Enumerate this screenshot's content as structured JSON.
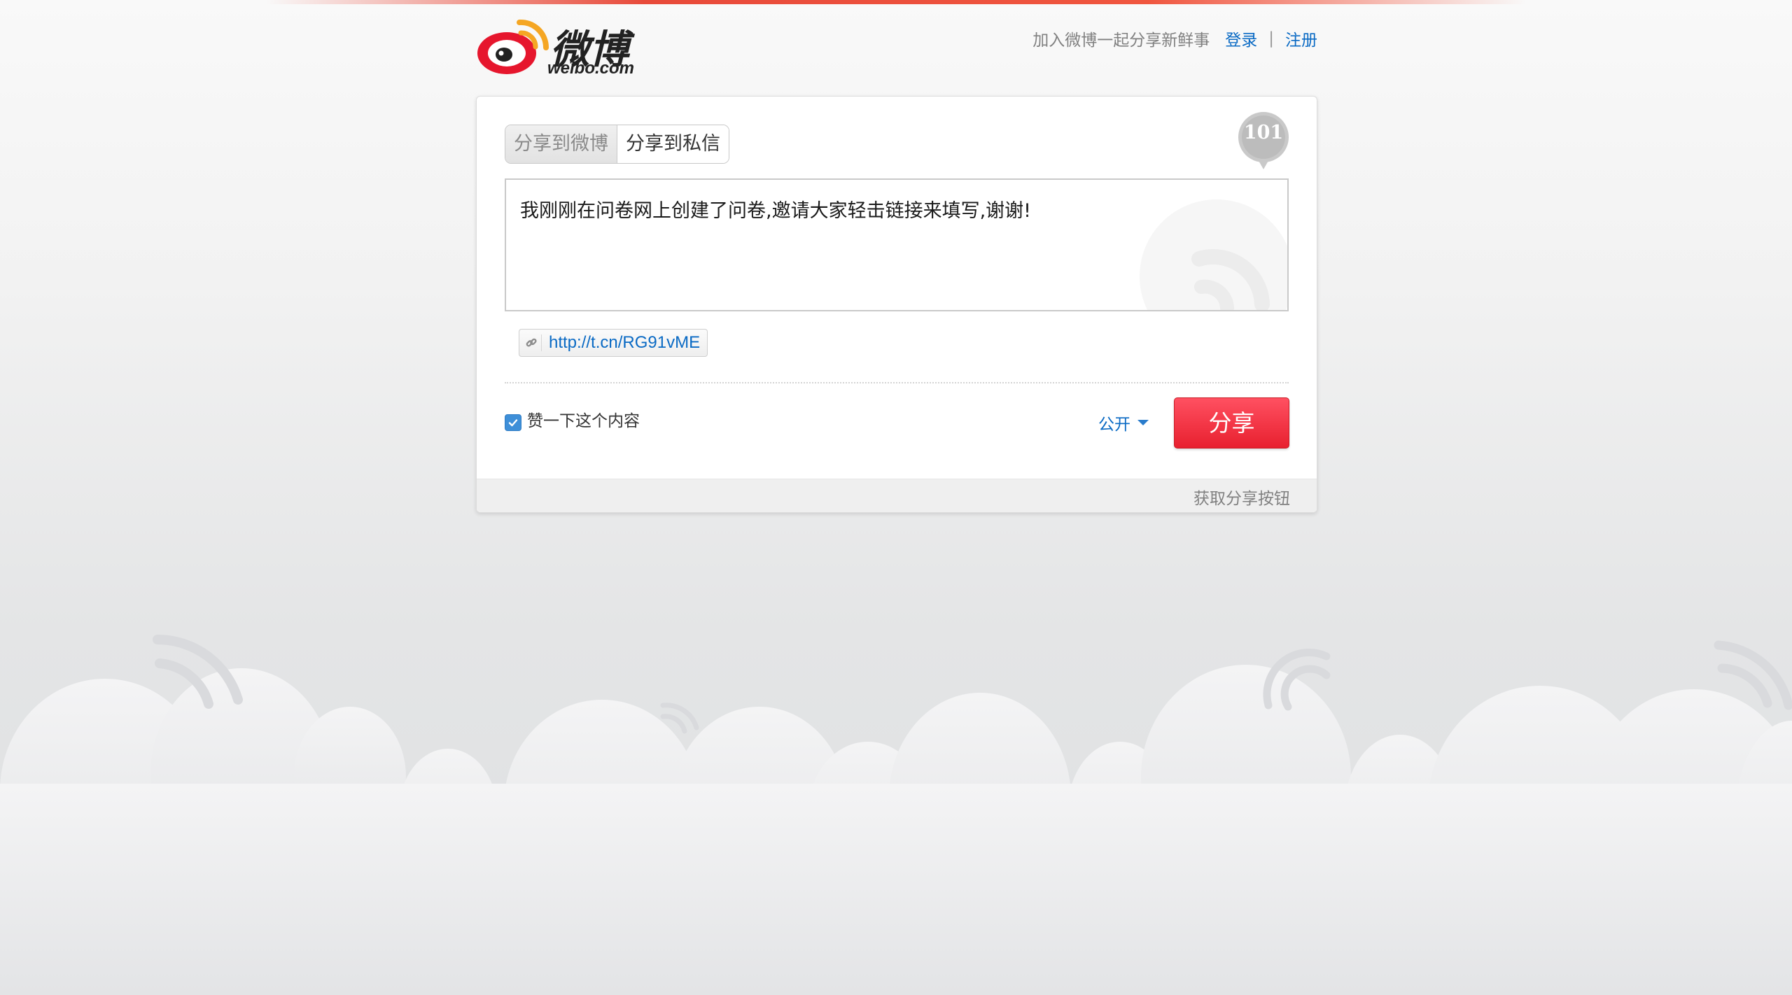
{
  "header": {
    "logo_text": "微博",
    "logo_domain": "weibo.com",
    "tagline": "加入微博一起分享新鲜事",
    "login": "登录",
    "separator": "|",
    "register": "注册"
  },
  "tabs": [
    {
      "label": "分享到微博",
      "active": true
    },
    {
      "label": "分享到私信",
      "active": false
    }
  ],
  "counter": "101",
  "message": "我刚刚在问卷网上创建了问卷,邀请大家轻击链接来填写,谢谢!",
  "short_link": "http://t.cn/RG91vME",
  "like_checkbox": {
    "label": "赞一下这个内容",
    "checked": true
  },
  "privacy": {
    "selected": "公开"
  },
  "share_button": "分享",
  "footer": {
    "get_button": "获取分享按钮"
  },
  "colors": {
    "accent_red": "#e8202f",
    "link_blue": "#0a6ac4",
    "checkbox_blue": "#3e8fd8"
  },
  "icons": [
    "weibo-logo-icon",
    "chain-link-icon",
    "caret-down-icon",
    "checkmark-icon",
    "speech-bubble-icon"
  ]
}
